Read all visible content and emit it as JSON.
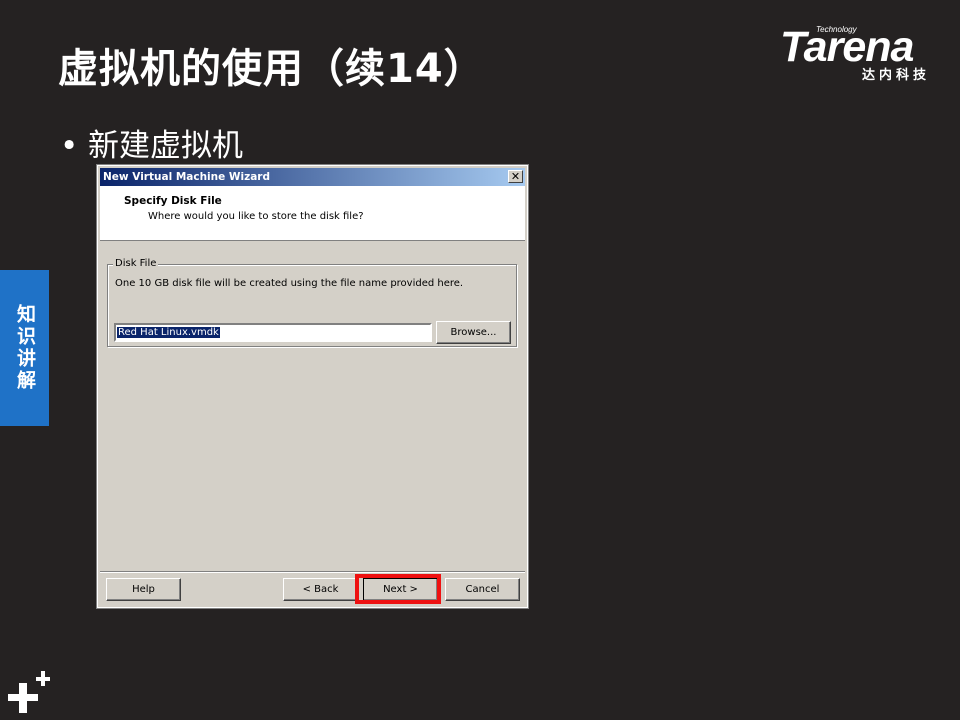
{
  "slide": {
    "title": "虚拟机的使用（续14）",
    "bullet": "新建虚拟机",
    "side_tab": "知识讲解"
  },
  "logo": {
    "small": "Technology",
    "main": "Tarena",
    "sub": "达内科技"
  },
  "dialog": {
    "title": "New Virtual Machine Wizard",
    "close_glyph": "✕",
    "header_title": "Specify Disk File",
    "header_subtitle": "Where would you like to store the disk file?",
    "group_label": "Disk File",
    "group_description": "One 10 GB disk file will be created using the file name provided here.",
    "file_name_value": "Red Hat Linux.vmdk",
    "browse_label": "Browse...",
    "help_label": "Help",
    "back_label": "< Back",
    "next_label": "Next >",
    "cancel_label": "Cancel"
  },
  "colors": {
    "slide_background": "#252222",
    "side_tab": "#1f72c7",
    "highlight": "#ee1111",
    "titlebar_start": "#0a246a",
    "titlebar_end": "#a6caf0",
    "dialog_face": "#d4d0c8"
  }
}
